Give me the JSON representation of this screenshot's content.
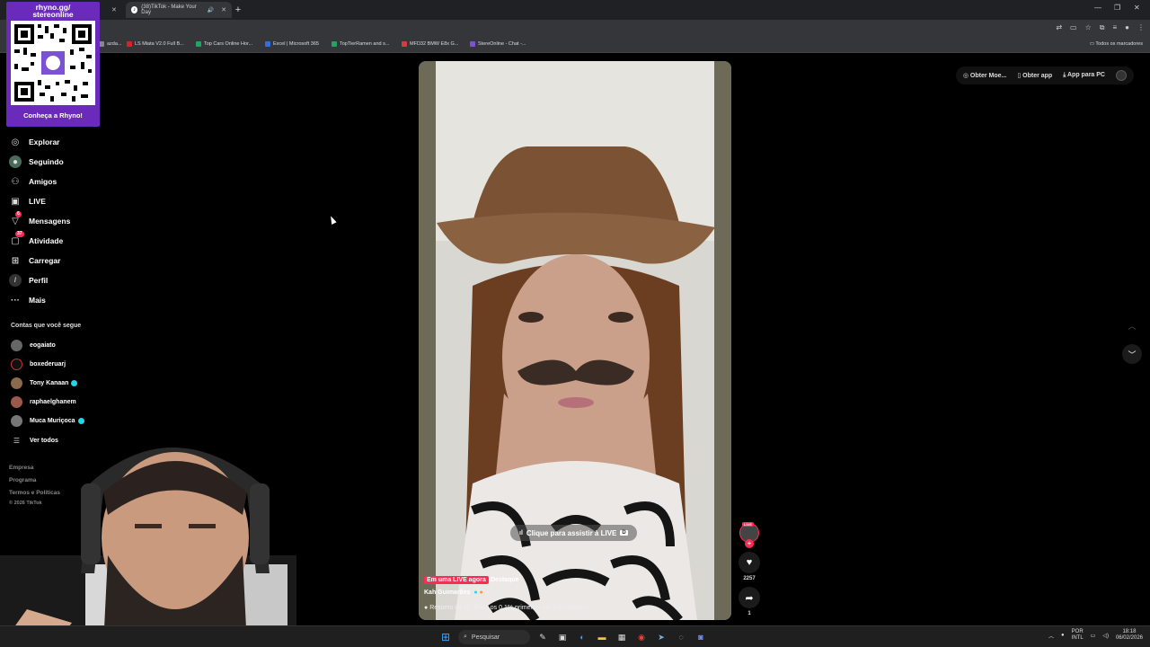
{
  "browser": {
    "tabs": [
      {
        "title": "(38)TikTok - Make Your Day"
      }
    ],
    "bookmarks": [
      {
        "label": "azda...",
        "color": "#888888"
      },
      {
        "label": "LS Miata V2.0 Full B...",
        "color": "#e02020"
      },
      {
        "label": "Top Cars Online Hor...",
        "color": "#21a366"
      },
      {
        "label": "Excel | Microsoft 365",
        "color": "#2f6fe0"
      },
      {
        "label": "TopTierRamen and s...",
        "color": "#21a366"
      },
      {
        "label": "MFD32 BMW E8x G...",
        "color": "#d83b3b"
      },
      {
        "label": "StereOnline - Chat -...",
        "color": "#7b52d6"
      }
    ],
    "all_bookmarks": "Todos os marcadores"
  },
  "qr": {
    "title_line1": "rhyno.gg/",
    "title_line2": "stereonline",
    "cta": "Conheça a Rhyno!"
  },
  "sidebar": {
    "items": [
      {
        "label": "Explorar",
        "icon": "compass-icon"
      },
      {
        "label": "Seguindo",
        "icon": "following-icon"
      },
      {
        "label": "Amigos",
        "icon": "friends-icon"
      },
      {
        "label": "LIVE",
        "icon": "live-icon"
      },
      {
        "label": "Mensagens",
        "icon": "messages-icon",
        "badge": "6"
      },
      {
        "label": "Atividade",
        "icon": "activity-icon",
        "badge": "37"
      },
      {
        "label": "Carregar",
        "icon": "upload-icon"
      },
      {
        "label": "Perfil",
        "icon": "profile-icon"
      },
      {
        "label": "Mais",
        "icon": "more-icon"
      }
    ],
    "following_heading": "Contas que você segue",
    "following": [
      {
        "name": "eogaiato",
        "verified": false
      },
      {
        "name": "boxederuarj",
        "verified": false
      },
      {
        "name": "Tony Kanaan",
        "verified": true
      },
      {
        "name": "raphaelghanem",
        "verified": false
      },
      {
        "name": "Muca Muriçoca",
        "verified": true
      }
    ],
    "see_all": "Ver todos",
    "footer": [
      "Empresa",
      "Programa",
      "Termos e Políticas",
      "© 2026 TikTok"
    ]
  },
  "topbar": {
    "coins": "Obter Moe...",
    "get_app": "Obter app",
    "pc_app": "App para PC"
  },
  "video": {
    "live_prompt": "Clique para assistir à LIVE",
    "live_key": "D",
    "live_tag": "Em uma LIVE agora",
    "featured": "Destaque",
    "username": "Kah Guimarães",
    "summary_prefix": "Resumo de AI",
    "summary": "Entre os 0.1% primeiros em espectadores"
  },
  "actions": {
    "live_badge": "LIVE",
    "likes": "2257",
    "shares": "1"
  },
  "taskbar": {
    "search": "Pesquisar",
    "lang_line1": "POR",
    "lang_line2": "INTL",
    "time": "18:18",
    "date": "06/02/2026"
  },
  "colors": {
    "accent": "#fe2c55",
    "verified": "#20d5ec",
    "qr_purple": "#6a2bbd"
  }
}
